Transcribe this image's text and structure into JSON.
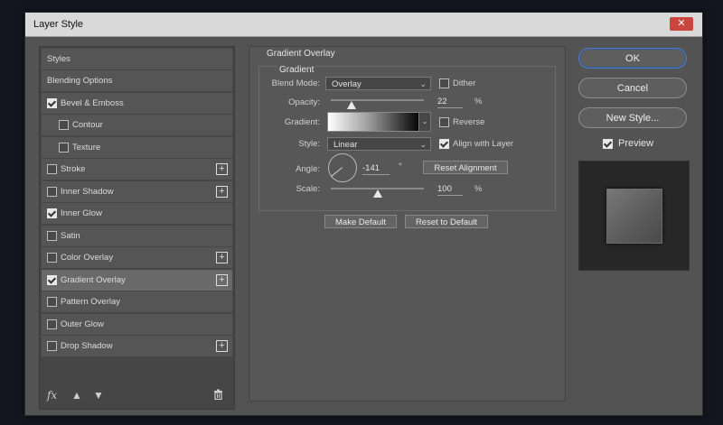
{
  "window": {
    "title": "Layer Style",
    "close_glyph": "✕"
  },
  "styles_list": {
    "header": "Styles",
    "items": [
      {
        "label": "Blending Options",
        "checkbox": false,
        "checked": false,
        "plus": false
      },
      {
        "label": "Bevel & Emboss",
        "checkbox": true,
        "checked": true,
        "plus": false
      },
      {
        "label": "Contour",
        "checkbox": true,
        "checked": false,
        "plus": false,
        "indent": true
      },
      {
        "label": "Texture",
        "checkbox": true,
        "checked": false,
        "plus": false,
        "indent": true
      },
      {
        "label": "Stroke",
        "checkbox": true,
        "checked": false,
        "plus": true
      },
      {
        "label": "Inner Shadow",
        "checkbox": true,
        "checked": false,
        "plus": true
      },
      {
        "label": "Inner Glow",
        "checkbox": true,
        "checked": true,
        "plus": false
      },
      {
        "label": "Satin",
        "checkbox": true,
        "checked": false,
        "plus": false
      },
      {
        "label": "Color Overlay",
        "checkbox": true,
        "checked": false,
        "plus": true
      },
      {
        "label": "Gradient Overlay",
        "checkbox": true,
        "checked": true,
        "plus": true,
        "selected": true
      },
      {
        "label": "Pattern Overlay",
        "checkbox": true,
        "checked": false,
        "plus": false
      },
      {
        "label": "Outer Glow",
        "checkbox": true,
        "checked": false,
        "plus": false
      },
      {
        "label": "Drop Shadow",
        "checkbox": true,
        "checked": false,
        "plus": true
      }
    ],
    "fx_label": "fx",
    "icons": [
      "fx-icon",
      "move-up-icon",
      "move-down-icon",
      "trash-icon"
    ],
    "plus_glyph": "+"
  },
  "gradient_overlay": {
    "section_title": "Gradient Overlay",
    "group_title": "Gradient",
    "blend_mode": {
      "label": "Blend Mode:",
      "value": "Overlay"
    },
    "dither": {
      "label": "Dither",
      "checked": false
    },
    "opacity": {
      "label": "Opacity:",
      "value": "22",
      "unit": "%",
      "fraction": 0.22
    },
    "gradient": {
      "label": "Gradient:"
    },
    "reverse": {
      "label": "Reverse",
      "checked": false
    },
    "style": {
      "label": "Style:",
      "value": "Linear"
    },
    "align_with_layer": {
      "label": "Align with Layer",
      "checked": true
    },
    "angle": {
      "label": "Angle:",
      "value": "-141",
      "unit": "°"
    },
    "reset_alignment": "Reset Alignment",
    "scale": {
      "label": "Scale:",
      "value": "100",
      "unit": "%",
      "fraction": 0.5
    },
    "make_default": "Make Default",
    "reset_to_default": "Reset to Default"
  },
  "actions": {
    "ok": "OK",
    "cancel": "Cancel",
    "new_style": "New Style...",
    "preview": {
      "label": "Preview",
      "checked": true
    }
  }
}
